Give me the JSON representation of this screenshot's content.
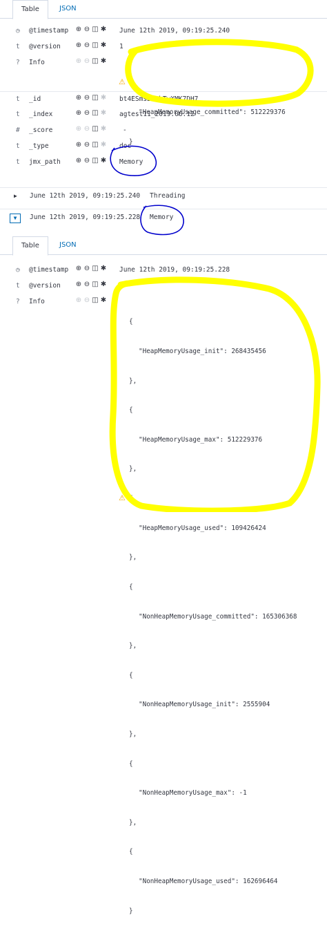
{
  "tabs": {
    "table": "Table",
    "json": "JSON"
  },
  "doc1": {
    "rows": [
      {
        "type": "clock-icon",
        "key": "@timestamp",
        "value": "June 12th 2019, 09:19:25.240"
      },
      {
        "type": "t",
        "key": "@version",
        "value": "1"
      },
      {
        "type": "?",
        "key": "Info",
        "json_lines": [
          "{",
          "\"HeapMemoryUsage_committed\": 512229376",
          "}"
        ]
      },
      {
        "type": "t",
        "key": "_id",
        "value": "bt4ESmsBQebTwXMK7DH7"
      },
      {
        "type": "t",
        "key": "_index",
        "value": "agtest11_2019.06.12"
      },
      {
        "type": "#",
        "key": "_score",
        "value": "-"
      },
      {
        "type": "t",
        "key": "_type",
        "value": "doc"
      },
      {
        "type": "t",
        "key": "jmx_path",
        "value": "Memory"
      }
    ]
  },
  "events": [
    {
      "time": "June 12th 2019, 09:19:25.240",
      "message": "Threading"
    },
    {
      "time": "June 12th 2019, 09:19:25.228",
      "message": "Memory"
    }
  ],
  "doc2": {
    "rows": [
      {
        "type": "clock-icon",
        "key": "@timestamp",
        "value": "June 12th 2019, 09:19:25.228"
      },
      {
        "type": "t",
        "key": "@version",
        "value": "1"
      },
      {
        "type": "?",
        "key": "Info",
        "json_lines": [
          "{",
          "\"HeapMemoryUsage_init\": 268435456",
          "},",
          "{",
          "\"HeapMemoryUsage_max\": 512229376",
          "},",
          "{",
          "\"HeapMemoryUsage_used\": 109426424",
          "},",
          "{",
          "\"NonHeapMemoryUsage_committed\": 165306368",
          "},",
          "{",
          "\"NonHeapMemoryUsage_init\": 2555904",
          "},",
          "{",
          "\"NonHeapMemoryUsage_max\": -1",
          "},",
          "{",
          "\"NonHeapMemoryUsage_used\": 162696464",
          "}"
        ]
      }
    ]
  },
  "colors": {
    "link": "#006bb4",
    "warning": "#f5a700",
    "highlight": "#ffff00",
    "pen": "#0000cc"
  }
}
